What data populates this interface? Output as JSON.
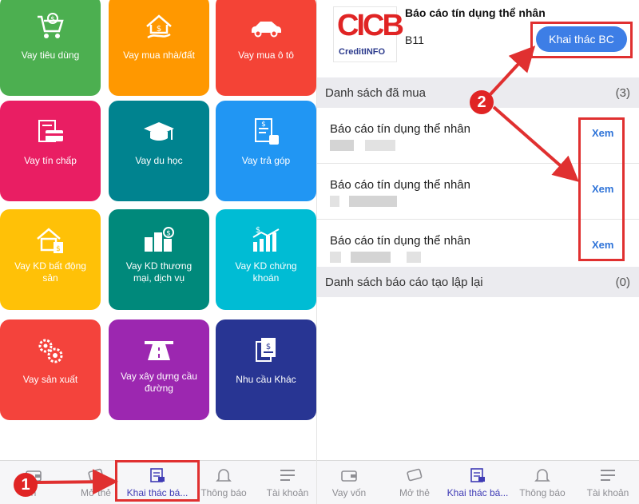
{
  "colors": {
    "green": "#4caf50",
    "orange": "#ff9800",
    "red": "#f44336",
    "pink": "#e91e63",
    "teal": "#00838f",
    "blue": "#2196f3",
    "yellow": "#ffc107",
    "teal2": "#00897b",
    "cyan": "#00bcd4",
    "red2": "#f4433c",
    "purple": "#9c27b0",
    "navy": "#283593",
    "accent": "#3d7ee6",
    "annotation": "#e03030"
  },
  "tiles": [
    {
      "label": "Vay tiêu dùng",
      "icon": "cart-icon"
    },
    {
      "label": "Vay mua nhà/đất",
      "icon": "house-icon"
    },
    {
      "label": "Vay mua ô tô",
      "icon": "car-icon"
    },
    {
      "label": "Vay tín chấp",
      "icon": "credit-card-icon"
    },
    {
      "label": "Vay du học",
      "icon": "graduation-cap-icon"
    },
    {
      "label": "Vay trả góp",
      "icon": "document-stamp-icon"
    },
    {
      "label": "Vay KD bất động sản",
      "icon": "building-money-icon"
    },
    {
      "label": "Vay KD thương mại, dịch vụ",
      "icon": "city-money-icon"
    },
    {
      "label": "Vay KD chứng khoán",
      "icon": "stock-chart-icon"
    },
    {
      "label": "Vay sản xuất",
      "icon": "gears-icon"
    },
    {
      "label": "Vay xây dựng cầu đường",
      "icon": "road-icon"
    },
    {
      "label": "Nhu cầu Khác",
      "icon": "documents-icon"
    }
  ],
  "left_nav": [
    {
      "label": "n",
      "icon": "wallet-icon"
    },
    {
      "label": "Mở thẻ",
      "icon": "card-icon"
    },
    {
      "label": "Khai thác bá...",
      "icon": "report-icon"
    },
    {
      "label": "Thông báo",
      "icon": "bell-icon"
    },
    {
      "label": "Tài khoản",
      "icon": "menu-icon"
    }
  ],
  "right_nav": [
    {
      "label": "Vay vốn",
      "icon": "wallet-icon"
    },
    {
      "label": "Mở thẻ",
      "icon": "card-icon"
    },
    {
      "label": "Khai thác bá...",
      "icon": "report-icon"
    },
    {
      "label": "Thông báo",
      "icon": "bell-icon"
    },
    {
      "label": "Tài khoản",
      "icon": "menu-icon"
    }
  ],
  "report": {
    "logo_text": "CICB",
    "logo_sub": "CreditINFO",
    "title": "Báo cáo tín dụng thể nhân",
    "code": "B11",
    "button_label": "Khai thác BC"
  },
  "purchased": {
    "title": "Danh sách đã mua",
    "count": "(3)",
    "rows": [
      {
        "name": "Báo cáo tín dụng thể nhân",
        "action": "Xem"
      },
      {
        "name": "Báo cáo tín dụng thể nhân",
        "action": "Xem"
      },
      {
        "name": "Báo cáo tín dụng thể nhân",
        "action": "Xem"
      }
    ]
  },
  "recreated": {
    "title": "Danh sách báo cáo tạo lập lại",
    "count": "(0)"
  },
  "badges": {
    "one": "1",
    "two": "2"
  }
}
